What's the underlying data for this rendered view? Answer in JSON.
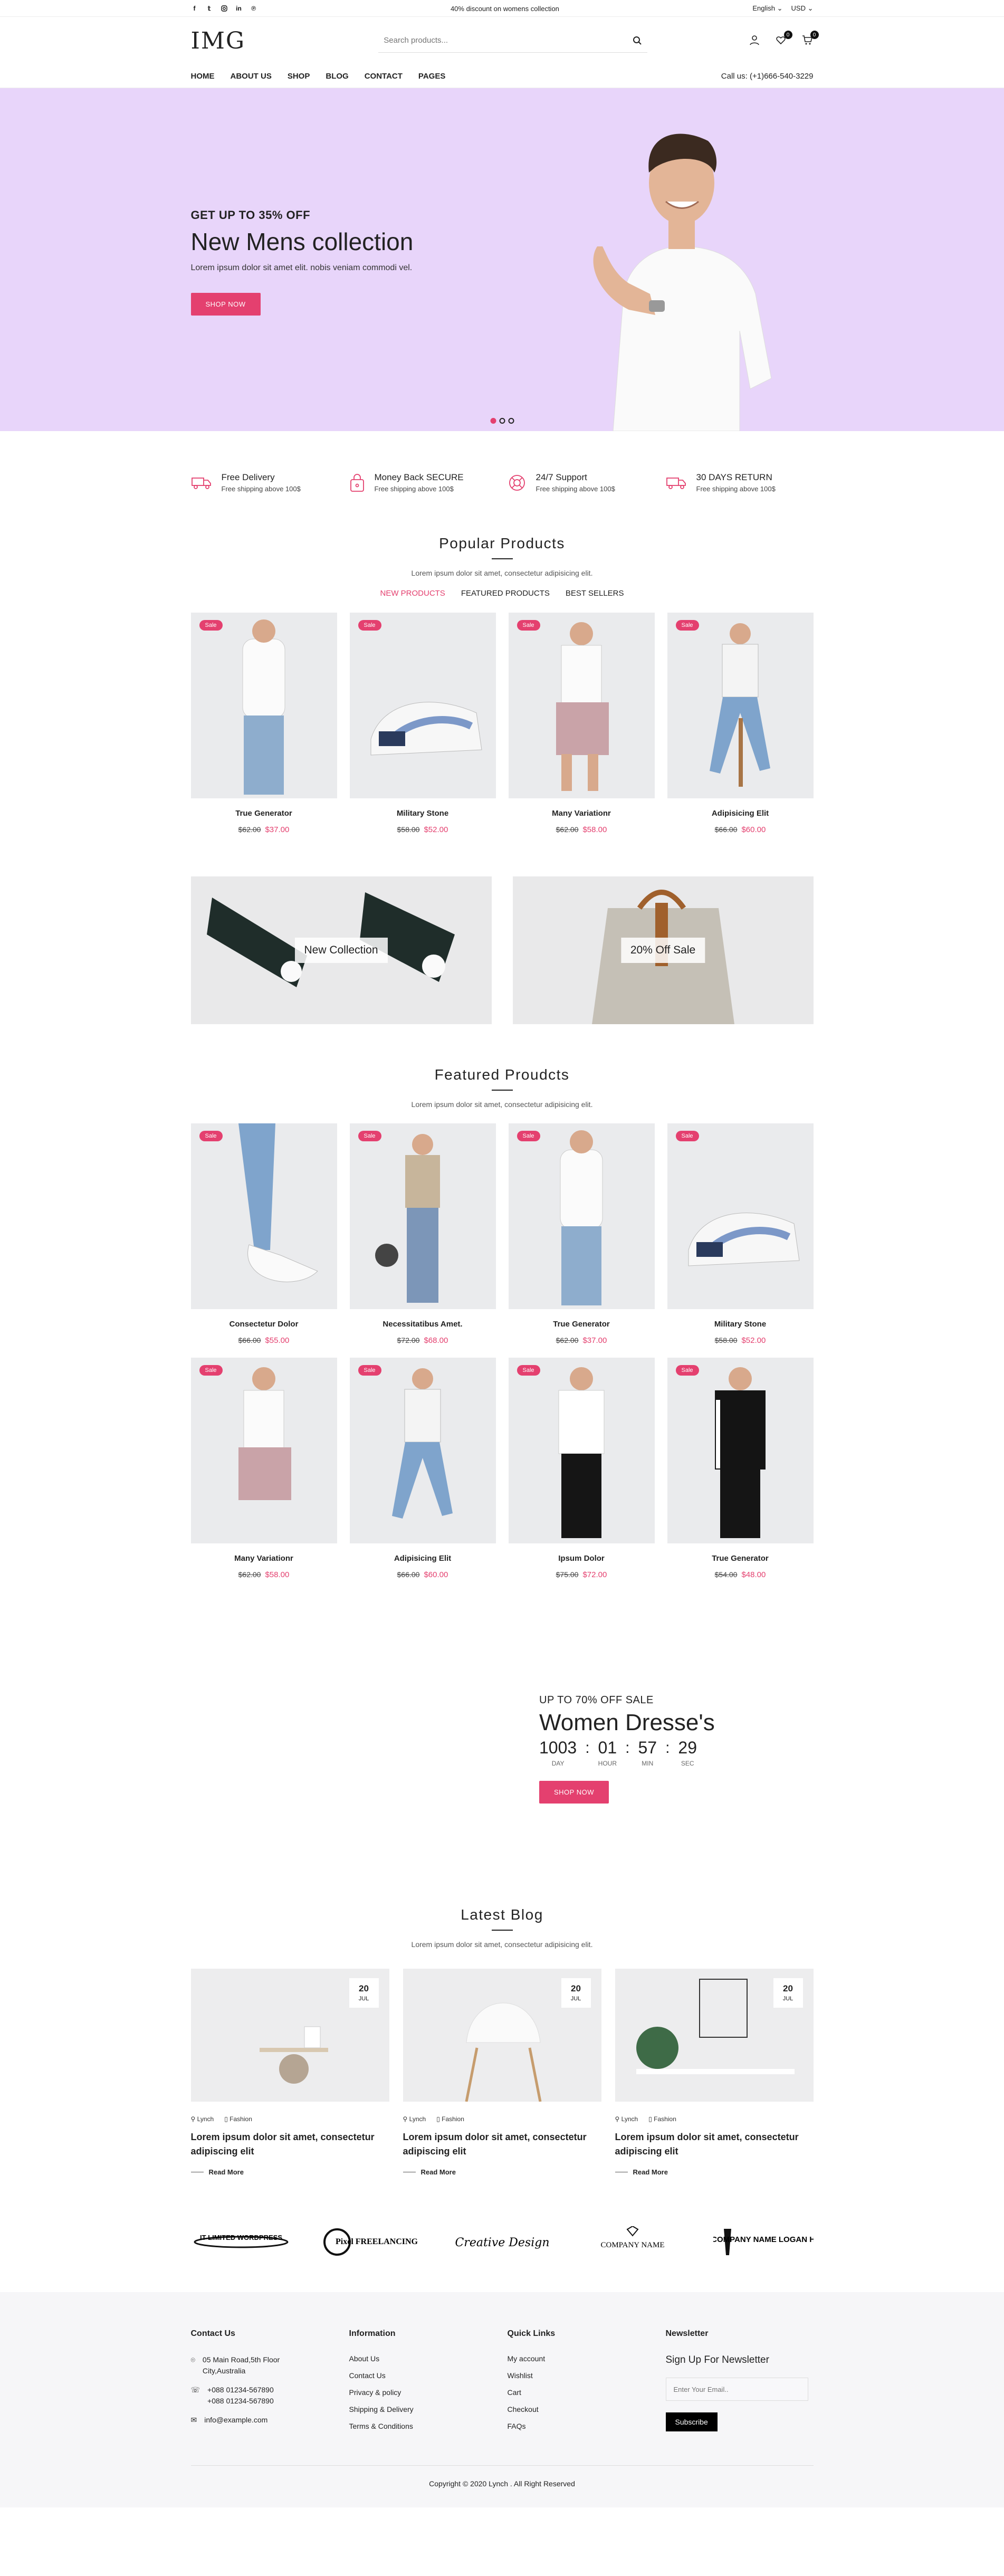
{
  "topbar": {
    "promo": "40% discount on womens collection",
    "language": "English",
    "currency": "USD"
  },
  "header": {
    "logo": "IMG",
    "search_placeholder": "Search products...",
    "wishlist_count": "0",
    "cart_count": "0",
    "nav": [
      "HOME",
      "ABOUT US",
      "SHOP",
      "BLOG",
      "CONTACT",
      "PAGES"
    ],
    "phone": "Call us: (+1)666-540-3229"
  },
  "hero": {
    "kicker": "GET UP TO 35% OFF",
    "title": "New Mens collection",
    "text": "Lorem ipsum dolor sit amet elit. nobis veniam commodi vel.",
    "button": "SHOP NOW"
  },
  "features": [
    {
      "title": "Free Delivery",
      "sub": "Free shipping above 100$",
      "icon": "truck-icon"
    },
    {
      "title": "Money Back SECURE",
      "sub": "Free shipping above 100$",
      "icon": "bag-lock-icon"
    },
    {
      "title": "24/7 Support",
      "sub": "Free shipping above 100$",
      "icon": "support-icon"
    },
    {
      "title": "30 DAYS RETURN",
      "sub": "Free shipping above 100$",
      "icon": "return-truck-icon"
    }
  ],
  "popular": {
    "title": "Popular Products",
    "subtitle": "Lorem ipsum dolor sit amet, consectetur adipisicing elit.",
    "tabs": [
      "NEW PRODUCTS",
      "FEATURED PRODUCTS",
      "BEST SELLERS"
    ],
    "items": [
      {
        "sale": "Sale",
        "name": "True Generator",
        "old": "$62.00",
        "new": "$37.00"
      },
      {
        "sale": "Sale",
        "name": "Military Stone",
        "old": "$58.00",
        "new": "$52.00"
      },
      {
        "sale": "Sale",
        "name": "Many Variationr",
        "old": "$62.00",
        "new": "$58.00"
      },
      {
        "sale": "Sale",
        "name": "Adipisicing Elit",
        "old": "$66.00",
        "new": "$60.00"
      }
    ]
  },
  "banners": [
    "New Collection",
    "20% Off Sale"
  ],
  "featured": {
    "title": "Featured Proudcts",
    "subtitle": "Lorem ipsum dolor sit amet, consectetur adipisicing elit.",
    "items": [
      {
        "sale": "Sale",
        "name": "Consectetur Dolor",
        "old": "$66.00",
        "new": "$55.00"
      },
      {
        "sale": "Sale",
        "name": "Necessitatibus Amet.",
        "old": "$72.00",
        "new": "$68.00"
      },
      {
        "sale": "Sale",
        "name": "True Generator",
        "old": "$62.00",
        "new": "$37.00"
      },
      {
        "sale": "Sale",
        "name": "Military Stone",
        "old": "$58.00",
        "new": "$52.00"
      },
      {
        "sale": "Sale",
        "name": "Many Variationr",
        "old": "$62.00",
        "new": "$58.00"
      },
      {
        "sale": "Sale",
        "name": "Adipisicing Elit",
        "old": "$66.00",
        "new": "$60.00"
      },
      {
        "sale": "Sale",
        "name": "Ipsum Dolor",
        "old": "$75.00",
        "new": "$72.00"
      },
      {
        "sale": "Sale",
        "name": "True Generator",
        "old": "$54.00",
        "new": "$48.00"
      }
    ]
  },
  "countdown": {
    "kicker": "UP TO 70% OFF SALE",
    "title": "Women Dresse's",
    "days": "1003",
    "hours": "01",
    "mins": "57",
    "secs": "29",
    "units": [
      "DAY",
      "HOUR",
      "MIN",
      "SEC"
    ],
    "button": "SHOP NOW"
  },
  "blog": {
    "title": "Latest Blog",
    "subtitle": "Lorem ipsum dolor sit amet, consectetur adipisicing elit.",
    "posts": [
      {
        "day": "20",
        "month": "JUL",
        "author": "Lynch",
        "cat": "Fashion",
        "title": "Lorem ipsum dolor sit amet, consectetur adipiscing elit",
        "more": "Read More"
      },
      {
        "day": "20",
        "month": "JUL",
        "author": "Lynch",
        "cat": "Fashion",
        "title": "Lorem ipsum dolor sit amet, consectetur adipiscing elit",
        "more": "Read More"
      },
      {
        "day": "20",
        "month": "JUL",
        "author": "Lynch",
        "cat": "Fashion",
        "title": "Lorem ipsum dolor sit amet, consectetur adipiscing elit",
        "more": "Read More"
      }
    ]
  },
  "brands": [
    "IT LIMITED WORDPRESS",
    "Pixel FREELANCING",
    "Creative Design",
    "COMPANY NAME",
    "COMPANY NAME LOGAN HERE"
  ],
  "footer": {
    "contact": {
      "title": "Contact Us",
      "address": "05 Main Road,5th Floor City,Australia",
      "phone1": "+088 01234-567890",
      "phone2": "+088 01234-567890",
      "email": "info@example.com"
    },
    "info": {
      "title": "Information",
      "links": [
        "About Us",
        "Contact Us",
        "Privacy & policy",
        "Shipping & Delivery",
        "Terms & Conditions"
      ]
    },
    "quick": {
      "title": "Quick Links",
      "links": [
        "My account",
        "Wishlist",
        "Cart",
        "Checkout",
        "FAQs"
      ]
    },
    "newsletter": {
      "title": "Newsletter",
      "heading": "Sign Up For Newsletter",
      "placeholder": "Enter Your Email..",
      "button": "Subscribe"
    },
    "copyright": "Copyright © 2020 Lynch . All Right Reserved"
  },
  "colors": {
    "accent": "#e4406f",
    "hero_bg": "#e8d5fa"
  }
}
